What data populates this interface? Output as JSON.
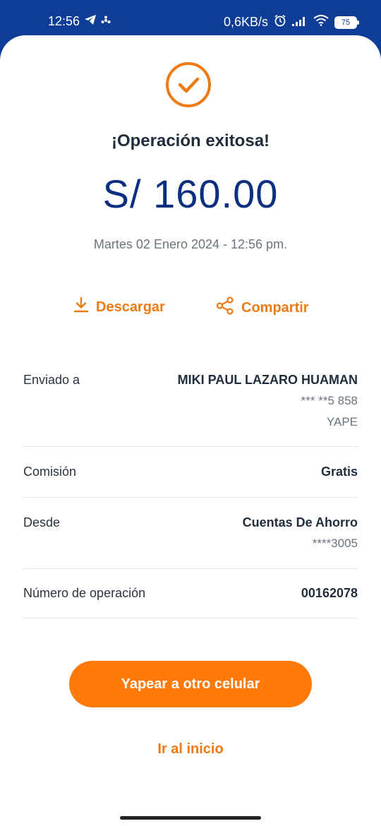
{
  "status_bar": {
    "time": "12:56",
    "network_speed": "0,6KB/s",
    "battery": "75",
    "icons": [
      "telegram-icon",
      "fan-icon",
      "alarm-icon",
      "signal-icon",
      "wifi-icon",
      "battery-icon"
    ]
  },
  "receipt": {
    "title": "¡Operación exitosa!",
    "amount": "S/ 160.00",
    "datetime": "Martes 02 Enero 2024 - 12:56 pm.",
    "status_icon": "check-icon"
  },
  "actions": {
    "download_label": "Descargar",
    "download_icon": "download-icon",
    "share_label": "Compartir",
    "share_icon": "share-icon"
  },
  "details": {
    "sent_to": {
      "label": "Enviado a",
      "name": "MIKI PAUL LAZARO HUAMAN",
      "phone": "*** **5 858",
      "service": "YAPE"
    },
    "commission": {
      "label": "Comisión",
      "value": "Gratis"
    },
    "from": {
      "label": "Desde",
      "account": "Cuentas De Ahorro",
      "number": "****3005"
    },
    "operation": {
      "label": "Número de operación",
      "value": "00162078"
    }
  },
  "buttons": {
    "primary_label": "Yapear a otro celular",
    "home_label": "Ir al inicio"
  },
  "colors": {
    "brand_blue": "#0d3d97",
    "amount_blue": "#0d2f82",
    "accent_orange": "#ff7a09"
  }
}
